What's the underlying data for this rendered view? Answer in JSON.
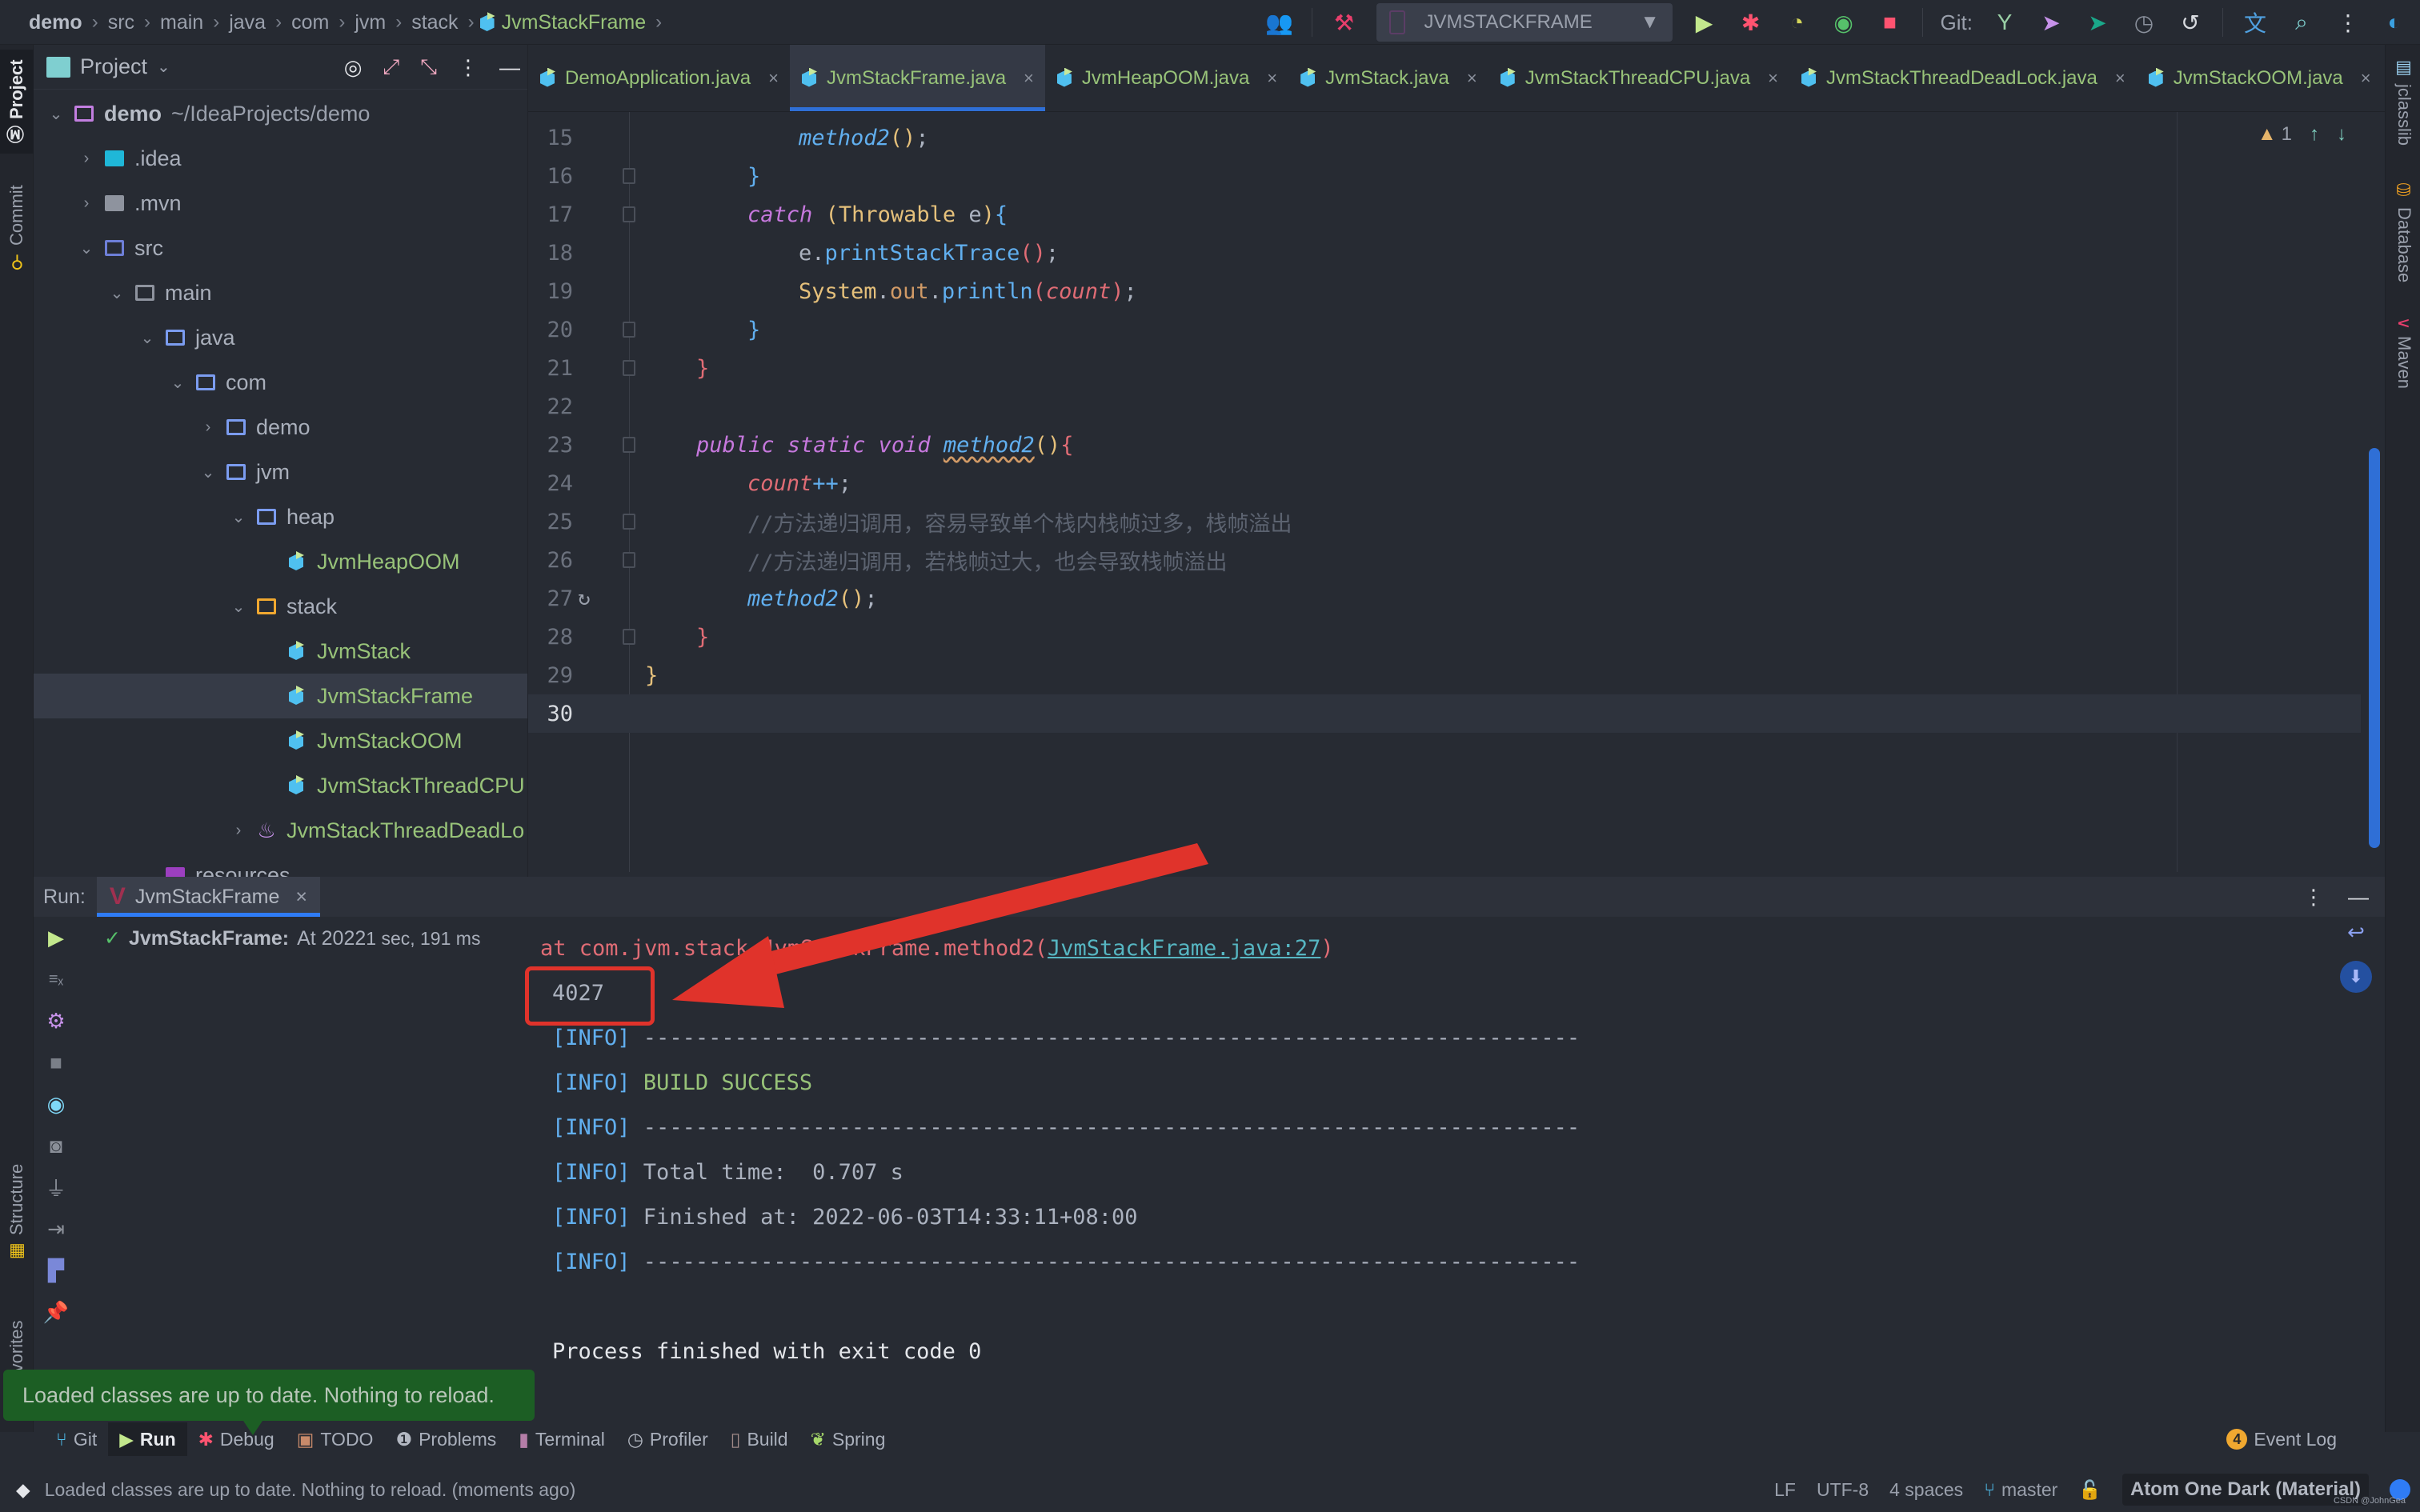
{
  "breadcrumb": [
    "demo",
    "src",
    "main",
    "java",
    "com",
    "jvm",
    "stack",
    "JvmStackFrame"
  ],
  "toolbar": {
    "run_config": "JVMSTACKFRAME",
    "git_label": "Git:",
    "icons": [
      "users-icon",
      "build-hammer-icon",
      "run-icon",
      "debug-icon",
      "coverage-icon",
      "profile-icon",
      "stop-icon",
      "git-fetch-icon",
      "git-push-icon",
      "git-commit-icon",
      "history-icon",
      "rollback-icon",
      "translate-icon",
      "search-icon",
      "more-icon",
      "jetbrains-logo-icon"
    ]
  },
  "left_stripe": {
    "project": "Project",
    "commit": "Commit",
    "structure": "Structure",
    "favorites": "Favorites"
  },
  "right_stripe": {
    "jclasslib": "jclasslib",
    "database": "Database",
    "maven": "Maven"
  },
  "project_panel": {
    "title": "Project",
    "tree": [
      {
        "label": "demo",
        "path": "~/IdeaProjects/demo",
        "depth": 0,
        "arrow": "down",
        "icon": "module-folder",
        "bold": true
      },
      {
        "label": ".idea",
        "depth": 1,
        "arrow": "right",
        "icon": "idea-folder"
      },
      {
        "label": ".mvn",
        "depth": 1,
        "arrow": "right",
        "icon": "gray-folder"
      },
      {
        "label": "src",
        "depth": 1,
        "arrow": "down",
        "icon": "source-folder"
      },
      {
        "label": "main",
        "depth": 2,
        "arrow": "down",
        "icon": "plain-folder"
      },
      {
        "label": "java",
        "depth": 3,
        "arrow": "down",
        "icon": "blue-folder"
      },
      {
        "label": "com",
        "depth": 4,
        "arrow": "down",
        "icon": "blue-folder"
      },
      {
        "label": "demo",
        "depth": 5,
        "arrow": "right",
        "icon": "blue-folder"
      },
      {
        "label": "jvm",
        "depth": 5,
        "arrow": "down",
        "icon": "blue-folder"
      },
      {
        "label": "heap",
        "depth": 6,
        "arrow": "down",
        "icon": "blue-folder"
      },
      {
        "label": "JvmHeapOOM",
        "depth": 7,
        "arrow": "",
        "icon": "class"
      },
      {
        "label": "stack",
        "depth": 6,
        "arrow": "down",
        "icon": "package-folder"
      },
      {
        "label": "JvmStack",
        "depth": 7,
        "arrow": "",
        "icon": "class"
      },
      {
        "label": "JvmStackFrame",
        "depth": 7,
        "arrow": "",
        "icon": "class",
        "selected": true
      },
      {
        "label": "JvmStackOOM",
        "depth": 7,
        "arrow": "",
        "icon": "class"
      },
      {
        "label": "JvmStackThreadCPU",
        "depth": 7,
        "arrow": "",
        "icon": "class"
      },
      {
        "label": "JvmStackThreadDeadLo",
        "depth": 6,
        "arrow": "right",
        "icon": "java-file"
      },
      {
        "label": "resources",
        "depth": 3,
        "arrow": "down",
        "icon": "resources-folder"
      }
    ]
  },
  "tabs": [
    {
      "label": "DemoApplication.java",
      "active": false
    },
    {
      "label": "JvmStackFrame.java",
      "active": true
    },
    {
      "label": "JvmHeapOOM.java",
      "active": false
    },
    {
      "label": "JvmStack.java",
      "active": false
    },
    {
      "label": "JvmStackThreadCPU.java",
      "active": false
    },
    {
      "label": "JvmStackThreadDeadLock.java",
      "active": false
    },
    {
      "label": "JvmStackOOM.java",
      "active": false
    }
  ],
  "editor": {
    "warning_count": "1",
    "lines": [
      {
        "n": "15",
        "indent": 3,
        "tokens": [
          [
            "fn",
            "method2"
          ],
          [
            "br-y",
            "()"
          ],
          [
            "pl",
            ";"
          ]
        ]
      },
      {
        "n": "16",
        "indent": 2,
        "tokens": [
          [
            "br-b",
            "}"
          ]
        ],
        "fold": true
      },
      {
        "n": "17",
        "indent": 2,
        "tokens": [
          [
            "k",
            "catch"
          ],
          [
            "pl",
            " "
          ],
          [
            "br-y",
            "("
          ],
          [
            "ty",
            "Throwable"
          ],
          [
            "pl",
            " e"
          ],
          [
            "br-y",
            ")"
          ],
          [
            "br-b",
            "{"
          ]
        ],
        "fold": true
      },
      {
        "n": "18",
        "indent": 3,
        "tokens": [
          [
            "pl",
            "e."
          ],
          [
            "fnc",
            "printStackTrace"
          ],
          [
            "br-r",
            "()"
          ],
          [
            "pl",
            ";"
          ]
        ]
      },
      {
        "n": "19",
        "indent": 3,
        "tokens": [
          [
            "ty",
            "System"
          ],
          [
            "pl",
            "."
          ],
          [
            "fld",
            "out"
          ],
          [
            "pl",
            "."
          ],
          [
            "fnc",
            "println"
          ],
          [
            "br-r",
            "("
          ],
          [
            "var",
            "count"
          ],
          [
            "br-r",
            ")"
          ],
          [
            "pl",
            ";"
          ]
        ]
      },
      {
        "n": "20",
        "indent": 2,
        "tokens": [
          [
            "br-b",
            "}"
          ]
        ],
        "fold": true
      },
      {
        "n": "21",
        "indent": 1,
        "tokens": [
          [
            "br-r",
            "}"
          ]
        ],
        "fold": true
      },
      {
        "n": "22",
        "indent": 0,
        "tokens": []
      },
      {
        "n": "23",
        "indent": 1,
        "tokens": [
          [
            "k",
            "public static void"
          ],
          [
            "pl",
            " "
          ],
          [
            "fn wavy",
            "method2"
          ],
          [
            "br-y",
            "()"
          ],
          [
            "br-r",
            "{"
          ]
        ],
        "fold": true
      },
      {
        "n": "24",
        "indent": 2,
        "tokens": [
          [
            "var",
            "count"
          ],
          [
            "fnc",
            "++"
          ],
          [
            "pl",
            ";"
          ]
        ]
      },
      {
        "n": "25",
        "indent": 2,
        "tokens": [
          [
            "cm",
            "//方法递归调用，容易导致单个栈内栈帧过多，栈帧溢出"
          ]
        ],
        "fold": true
      },
      {
        "n": "26",
        "indent": 2,
        "tokens": [
          [
            "cm",
            "//方法递归调用，若栈帧过大，也会导致栈帧溢出"
          ]
        ],
        "fold": true
      },
      {
        "n": "27",
        "indent": 2,
        "tokens": [
          [
            "fn",
            "method2"
          ],
          [
            "br-y",
            "()"
          ],
          [
            "pl",
            ";"
          ]
        ],
        "recursion_marker": true
      },
      {
        "n": "28",
        "indent": 1,
        "tokens": [
          [
            "br-r",
            "}"
          ]
        ],
        "fold": true
      },
      {
        "n": "29",
        "indent": 0,
        "tokens": [
          [
            "br-y",
            "}"
          ]
        ]
      },
      {
        "n": "30",
        "indent": 0,
        "tokens": [],
        "current": true
      }
    ]
  },
  "run_panel": {
    "label": "Run:",
    "tab": "JvmStackFrame",
    "tree_item": {
      "name": "JvmStackFrame:",
      "desc": "At 2022",
      "time": "1 sec, 191 ms"
    },
    "console": [
      {
        "parts": [
          [
            "err",
            "    at com.jvm.stack.JvmStackFrame.method2("
          ],
          [
            "lnk",
            "JvmStackFrame.java:27"
          ],
          [
            "err",
            ")"
          ]
        ]
      },
      {
        "parts": [
          [
            "plain",
            "4027"
          ]
        ],
        "highlighted": true
      },
      {
        "parts": [
          [
            "info-br",
            "[INFO]"
          ],
          [
            "plain",
            " ------------------------------------------------------------------------"
          ]
        ]
      },
      {
        "parts": [
          [
            "info-br",
            "[INFO]"
          ],
          [
            "plain",
            " "
          ],
          [
            "succ",
            "BUILD SUCCESS"
          ]
        ]
      },
      {
        "parts": [
          [
            "info-br",
            "[INFO]"
          ],
          [
            "plain",
            " ------------------------------------------------------------------------"
          ]
        ]
      },
      {
        "parts": [
          [
            "info-br",
            "[INFO]"
          ],
          [
            "plain",
            " Total time:  0.707 s"
          ]
        ]
      },
      {
        "parts": [
          [
            "info-br",
            "[INFO]"
          ],
          [
            "plain",
            " Finished at: 2022-06-03T14:33:11+08:00"
          ]
        ]
      },
      {
        "parts": [
          [
            "info-br",
            "[INFO]"
          ],
          [
            "plain",
            " ------------------------------------------------------------------------"
          ]
        ]
      },
      {
        "parts": []
      },
      {
        "parts": [
          [
            "proc",
            "Process finished with exit code 0"
          ]
        ]
      }
    ]
  },
  "balloon": "Loaded classes are up to date. Nothing to reload.",
  "tool_windows": [
    {
      "label": "Git",
      "icon": "git-branch-icon",
      "color": "#4fc0f0"
    },
    {
      "label": "Run",
      "icon": "run-icon",
      "color": "#c3e88d",
      "active": true
    },
    {
      "label": "Debug",
      "icon": "debug-icon",
      "color": "#ff5370"
    },
    {
      "label": "TODO",
      "icon": "todo-icon",
      "color": "#c88a6a"
    },
    {
      "label": "Problems",
      "icon": "problems-icon",
      "color": "#b3b8c2"
    },
    {
      "label": "Terminal",
      "icon": "terminal-icon",
      "color": "#b57ea8"
    },
    {
      "label": "Profiler",
      "icon": "profiler-icon",
      "color": "#b3b8c2"
    },
    {
      "label": "Build",
      "icon": "build-icon",
      "color": "#a08a88"
    },
    {
      "label": "Spring",
      "icon": "spring-icon",
      "color": "#a6d86a"
    }
  ],
  "event_log": {
    "count": "4",
    "label": "Event Log"
  },
  "status_bar": {
    "message": "Loaded classes are up to date. Nothing to reload. (moments ago)",
    "line_sep": "LF",
    "encoding": "UTF-8",
    "indent": "4 spaces",
    "branch": "master",
    "theme": "Atom One Dark (Material)"
  },
  "watermark": "CSDN @JohnGea",
  "colors": {
    "accent": "#2f6fd6",
    "annotation_red": "#e0332b",
    "class_green": "#98c379"
  }
}
